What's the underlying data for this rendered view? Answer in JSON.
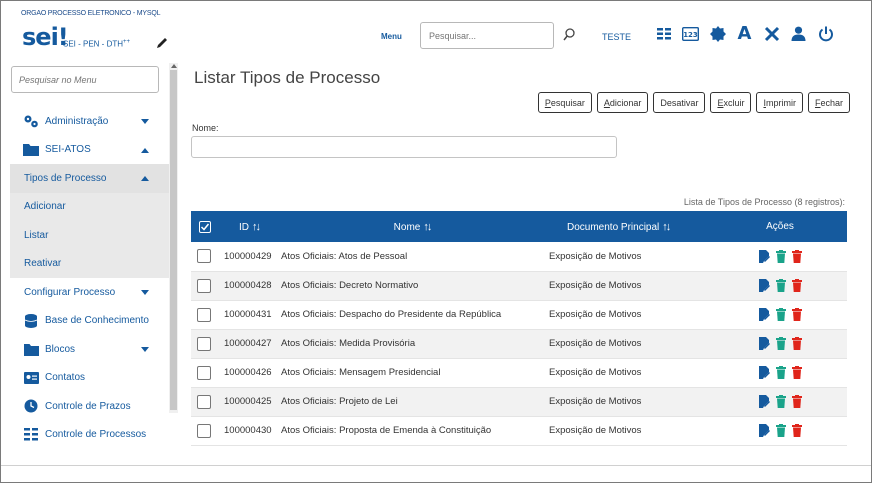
{
  "header": {
    "org": "ORGAO PROCESSO ELETRONICO - MYSQL",
    "logo": "sei!",
    "system": "SEI - PEN - DTH",
    "system_sup": "++",
    "menu_label": "Menu",
    "search_placeholder": "Pesquisar...",
    "unit": "TESTE",
    "icons": [
      "list-icon",
      "contrast-icon",
      "gear-badge-icon",
      "font-size-icon",
      "tools-icon",
      "user-icon",
      "power-icon"
    ],
    "font_letter": "A"
  },
  "sidebar": {
    "search_placeholder": "Pesquisar no Menu",
    "items": [
      {
        "label": "Administração",
        "icon": "gears-icon",
        "caret": "down"
      },
      {
        "label": "SEI-ATOS",
        "icon": "folder-icon",
        "caret": "up"
      },
      {
        "label": "Tipos de Processo",
        "caret": "up"
      },
      {
        "label": "Adicionar"
      },
      {
        "label": "Listar"
      },
      {
        "label": "Reativar"
      },
      {
        "label": "Configurar Processo",
        "caret": "down"
      },
      {
        "label": "Base de Conhecimento",
        "icon": "database-icon"
      },
      {
        "label": "Blocos",
        "icon": "folder-icon",
        "caret": "down"
      },
      {
        "label": "Contatos",
        "icon": "contact-card-icon"
      },
      {
        "label": "Controle de Prazos",
        "icon": "clock-icon"
      },
      {
        "label": "Controle de Processos",
        "icon": "list-icon"
      }
    ]
  },
  "main": {
    "title": "Listar Tipos de Processo",
    "buttons": [
      {
        "first": "P",
        "rest": "esquisar"
      },
      {
        "first": "A",
        "rest": "dicionar"
      },
      {
        "first": "",
        "rest": "Desativar"
      },
      {
        "first": "E",
        "rest": "xcluir"
      },
      {
        "first": "I",
        "rest": "mprimir"
      },
      {
        "first": "F",
        "rest": "echar"
      }
    ],
    "name_label": "Nome:",
    "caption": "Lista de Tipos de Processo (8 registros):",
    "table": {
      "headers": {
        "id": "ID",
        "name": "Nome",
        "doc": "Documento Principal",
        "actions": "Ações"
      },
      "rows": [
        {
          "id": "100000429",
          "name": "Atos Oficiais: Atos de Pessoal",
          "doc": "Exposição de Motivos"
        },
        {
          "id": "100000428",
          "name": "Atos Oficiais: Decreto Normativo",
          "doc": "Exposição de Motivos"
        },
        {
          "id": "100000431",
          "name": "Atos Oficiais: Despacho do Presidente da República",
          "doc": "Exposição de Motivos"
        },
        {
          "id": "100000427",
          "name": "Atos Oficiais: Medida Provisória",
          "doc": "Exposição de Motivos"
        },
        {
          "id": "100000426",
          "name": "Atos Oficiais: Mensagem Presidencial",
          "doc": "Exposição de Motivos"
        },
        {
          "id": "100000425",
          "name": "Atos Oficiais: Projeto de Lei",
          "doc": "Exposição de Motivos"
        },
        {
          "id": "100000430",
          "name": "Atos Oficiais: Proposta de Emenda à Constituição",
          "doc": "Exposição de Motivos"
        }
      ]
    }
  },
  "colors": {
    "brand": "#155a9e",
    "action_edit": "#155a9e",
    "action_deactivate": "#1aa38a",
    "action_delete": "#e0251b"
  }
}
